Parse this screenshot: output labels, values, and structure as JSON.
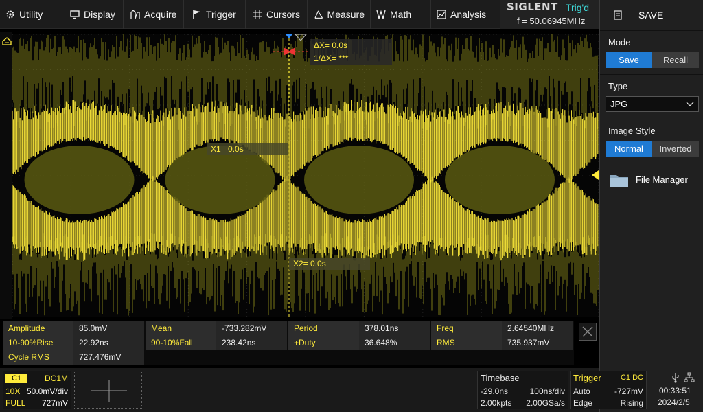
{
  "menu": [
    {
      "label": "Utility",
      "icon": "gear-icon"
    },
    {
      "label": "Display",
      "icon": "monitor-icon"
    },
    {
      "label": "Acquire",
      "icon": "acquire-icon"
    },
    {
      "label": "Trigger",
      "icon": "flag-icon"
    },
    {
      "label": "Cursors",
      "icon": "crosshair-icon"
    },
    {
      "label": "Measure",
      "icon": "measure-icon"
    },
    {
      "label": "Math",
      "icon": "math-icon"
    },
    {
      "label": "Analysis",
      "icon": "analysis-icon"
    }
  ],
  "brand": {
    "logo": "SIGLENT",
    "trig_status": "Trig'd",
    "freq": "f = 50.06945MHz"
  },
  "panel": {
    "title": "SAVE",
    "mode": {
      "label": "Mode",
      "options": [
        "Save",
        "Recall"
      ],
      "selected": "Save"
    },
    "type": {
      "label": "Type",
      "value": "JPG"
    },
    "image_style": {
      "label": "Image Style",
      "options": [
        "Normal",
        "Inverted"
      ],
      "selected": "Normal"
    },
    "file_manager": "File Manager"
  },
  "cursors": {
    "dx": "ΔX= 0.0s",
    "inv_dx": "1/ΔX= ***",
    "x1": "X1= 0.0s",
    "x2": "X2= 0.0s"
  },
  "measurements": [
    [
      {
        "name": "Amplitude",
        "value": "85.0mV"
      },
      {
        "name": "Mean",
        "value": "-733.282mV"
      },
      {
        "name": "Period",
        "value": "378.01ns"
      },
      {
        "name": "Freq",
        "value": "2.64540MHz"
      }
    ],
    [
      {
        "name": "10-90%Rise",
        "value": "22.92ns"
      },
      {
        "name": "90-10%Fall",
        "value": "238.42ns"
      },
      {
        "name": "+Duty",
        "value": "36.648%"
      },
      {
        "name": "RMS",
        "value": "735.937mV"
      }
    ],
    [
      {
        "name": "Cycle RMS",
        "value": "727.476mV"
      }
    ]
  ],
  "channel": {
    "tag": "C1",
    "coupling": "DC1M",
    "probe": "10X",
    "scale": "50.0mV/div",
    "bw": "FULL",
    "offset": "727mV"
  },
  "timebase": {
    "label": "Timebase",
    "delay": "-29.0ns",
    "scale": "100ns/div",
    "points": "2.00kpts",
    "rate": "2.00GSa/s"
  },
  "trigger": {
    "label": "Trigger",
    "source": "C1 DC",
    "mode": "Auto",
    "level": "-727mV",
    "type": "Edge",
    "slope": "Rising"
  },
  "clock": {
    "time": "00:33:51",
    "date": "2024/2/5"
  },
  "colors": {
    "trace": "#ffeb3b",
    "accent": "#1f7bd4",
    "trig_status": "#3fd9d9"
  }
}
